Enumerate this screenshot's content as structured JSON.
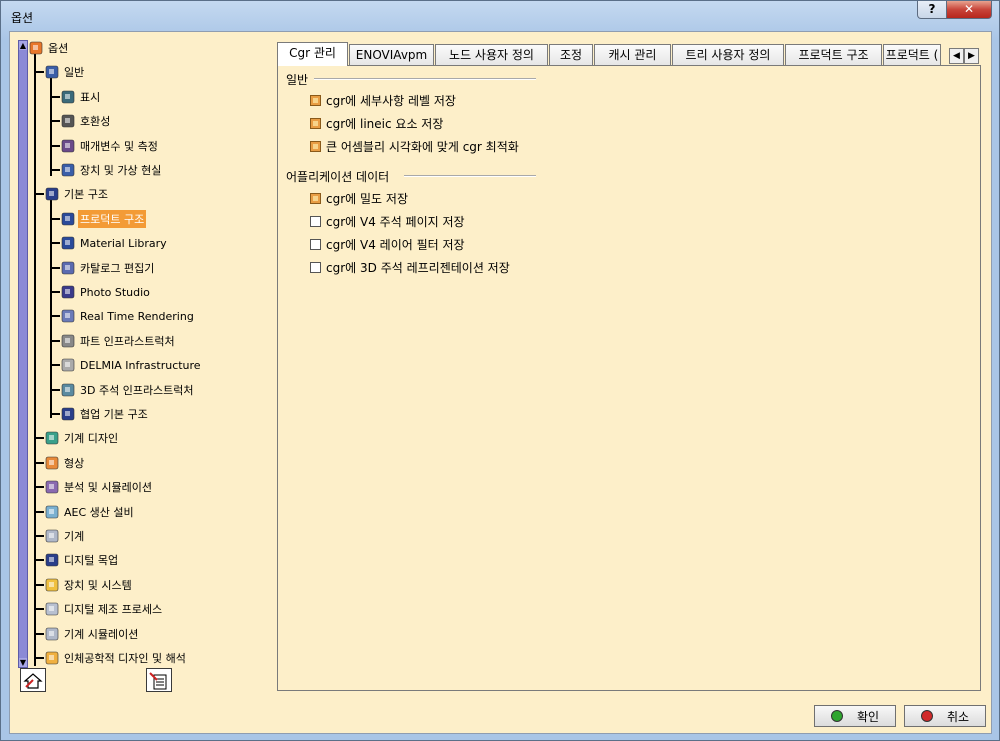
{
  "window": {
    "title": "옵션",
    "help_label": "?",
    "close_label": "✕"
  },
  "tree": {
    "items": [
      {
        "label": "옵션",
        "icon": "options-root-icon",
        "color": "#e8772a"
      },
      {
        "label": "일반",
        "icon": "general-icon",
        "color": "#3a5ea8"
      },
      {
        "label": "표시",
        "icon": "display-icon",
        "color": "#3b6a7a"
      },
      {
        "label": "호환성",
        "icon": "compatibility-icon",
        "color": "#555555"
      },
      {
        "label": "매개변수 및 측정",
        "icon": "parameters-icon",
        "color": "#6a4a8a"
      },
      {
        "label": "장치 및 가상 현실",
        "icon": "devices-vr-icon",
        "color": "#3a5ea8"
      },
      {
        "label": "기본 구조",
        "icon": "infrastructure-icon",
        "color": "#2a3e8a"
      },
      {
        "label": "프로덕트 구조",
        "icon": "product-structure-icon",
        "color": "#2a4a9a"
      },
      {
        "label": "Material Library",
        "icon": "material-library-icon",
        "color": "#2a4a9a"
      },
      {
        "label": "카탈로그 편집기",
        "icon": "catalog-editor-icon",
        "color": "#5a6ab0"
      },
      {
        "label": "Photo Studio",
        "icon": "photo-studio-icon",
        "color": "#3a3a8a"
      },
      {
        "label": "Real Time Rendering",
        "icon": "rendering-icon",
        "color": "#6a7ab8"
      },
      {
        "label": "파트 인프라스트럭처",
        "icon": "part-infra-icon",
        "color": "#888888"
      },
      {
        "label": "DELMIA Infrastructure",
        "icon": "delmia-icon",
        "color": "#aaaaaa"
      },
      {
        "label": "3D 주석 인프라스트럭처",
        "icon": "annotation-infra-icon",
        "color": "#5a8aa0"
      },
      {
        "label": "협업 기본 구조",
        "icon": "collab-infra-icon",
        "color": "#2a3e8a"
      },
      {
        "label": "기계 디자인",
        "icon": "mechanical-design-icon",
        "color": "#3aa08a"
      },
      {
        "label": "형상",
        "icon": "shape-icon",
        "color": "#e88a3a"
      },
      {
        "label": "분석 및 시뮬레이션",
        "icon": "analysis-icon",
        "color": "#8a6ab0"
      },
      {
        "label": "AEC 생산 설비",
        "icon": "aec-plant-icon",
        "color": "#7ab0d0"
      },
      {
        "label": "기계",
        "icon": "machining-icon",
        "color": "#b0b8c8"
      },
      {
        "label": "디지털 목업",
        "icon": "digital-mockup-icon",
        "color": "#2a3e8a"
      },
      {
        "label": "장치 및 시스템",
        "icon": "equipment-systems-icon",
        "color": "#f0c040"
      },
      {
        "label": "디지털 제조 프로세스",
        "icon": "digital-process-icon",
        "color": "#b8c0d0"
      },
      {
        "label": "기계 시뮬레이션",
        "icon": "machine-simulation-icon",
        "color": "#b0b8c8"
      },
      {
        "label": "인체공학적 디자인 및 해석",
        "icon": "ergonomics-icon",
        "color": "#f0b040"
      }
    ]
  },
  "scroll": {
    "up_arrow": "▲",
    "down_arrow": "▼"
  },
  "tabs": [
    {
      "label": "Cgr 관리"
    },
    {
      "label": "ENOVIAvpm"
    },
    {
      "label": "노드 사용자 정의"
    },
    {
      "label": "조정"
    },
    {
      "label": "캐시 관리"
    },
    {
      "label": "트리 사용자 정의"
    },
    {
      "label": "프로덕트 구조"
    },
    {
      "label": "프로덕트 ("
    }
  ],
  "tab_nav": {
    "prev": "◀",
    "next": "▶"
  },
  "groups": {
    "general": {
      "title": "일반",
      "options": [
        {
          "label": "cgr에 세부사항 레벨 저장",
          "checked": true
        },
        {
          "label": "cgr에 lineic 요소 저장",
          "checked": true
        },
        {
          "label": "큰 어셈블리 시각화에 맞게 cgr 최적화",
          "checked": true
        }
      ]
    },
    "app_data": {
      "title": "어플리케이션 데이터",
      "options": [
        {
          "label": "cgr에 밀도 저장",
          "checked": true
        },
        {
          "label": "cgr에 V4 주석 페이지 저장",
          "checked": false
        },
        {
          "label": "cgr에 V4 레이어 필터 저장",
          "checked": false
        },
        {
          "label": "cgr에 3D 주석 레프리젠테이션 저장",
          "checked": false
        }
      ]
    }
  },
  "footer": {
    "ok_label": "확인",
    "cancel_label": "취소",
    "ok_color": "#2fa52f",
    "cancel_color": "#d02a2a"
  }
}
